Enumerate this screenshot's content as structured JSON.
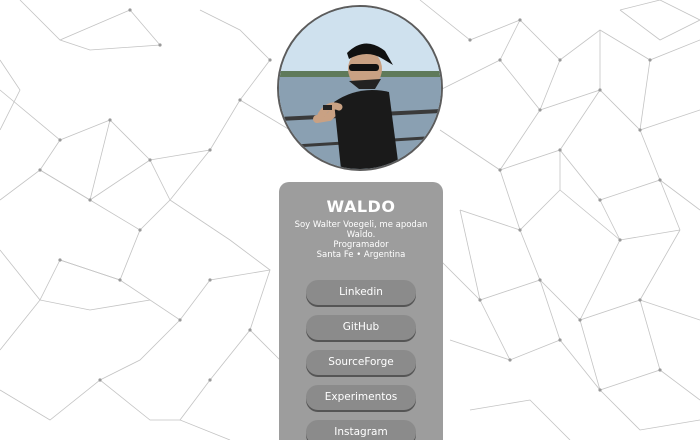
{
  "profile": {
    "name": "WALDO",
    "bio": "Soy Walter Voegeli, me apodan Waldo.",
    "role": "Programador",
    "location": "Santa Fe • Argentina"
  },
  "links": [
    {
      "label": "Linkedin"
    },
    {
      "label": "GitHub"
    },
    {
      "label": "SourceForge"
    },
    {
      "label": "Experimentos"
    },
    {
      "label": "Instagram"
    }
  ],
  "colors": {
    "card_background": "#9d9d9d",
    "button_background": "#8b8b8b",
    "text": "#ffffff",
    "network_lines": "#bdbdbd"
  }
}
